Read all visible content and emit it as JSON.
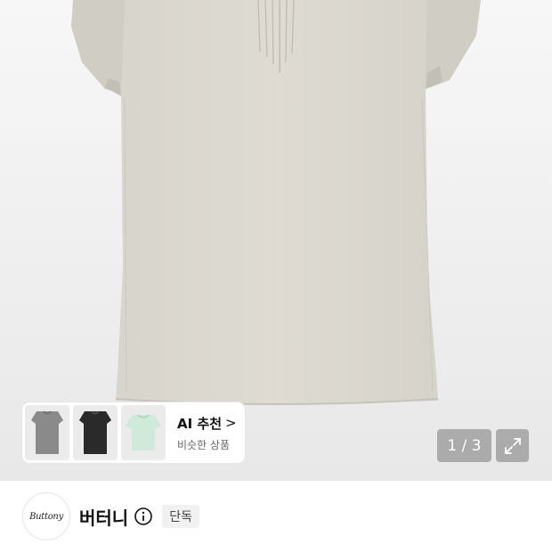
{
  "hero": {
    "product_image": "beige-cap-sleeve-knit-top"
  },
  "ai_card": {
    "title": "AI 추천",
    "chevron": ">",
    "subtitle": "비슷한 상품",
    "thumbnails": [
      "gray-top-thumbnail",
      "black-top-thumbnail",
      "mint-top-thumbnail"
    ]
  },
  "pager": {
    "text": "1 / 3"
  },
  "icons": {
    "expand": "expand-icon",
    "info": "info-icon"
  },
  "brand": {
    "logo_text": "Buttony",
    "name": "버터니",
    "badge": "단독"
  }
}
